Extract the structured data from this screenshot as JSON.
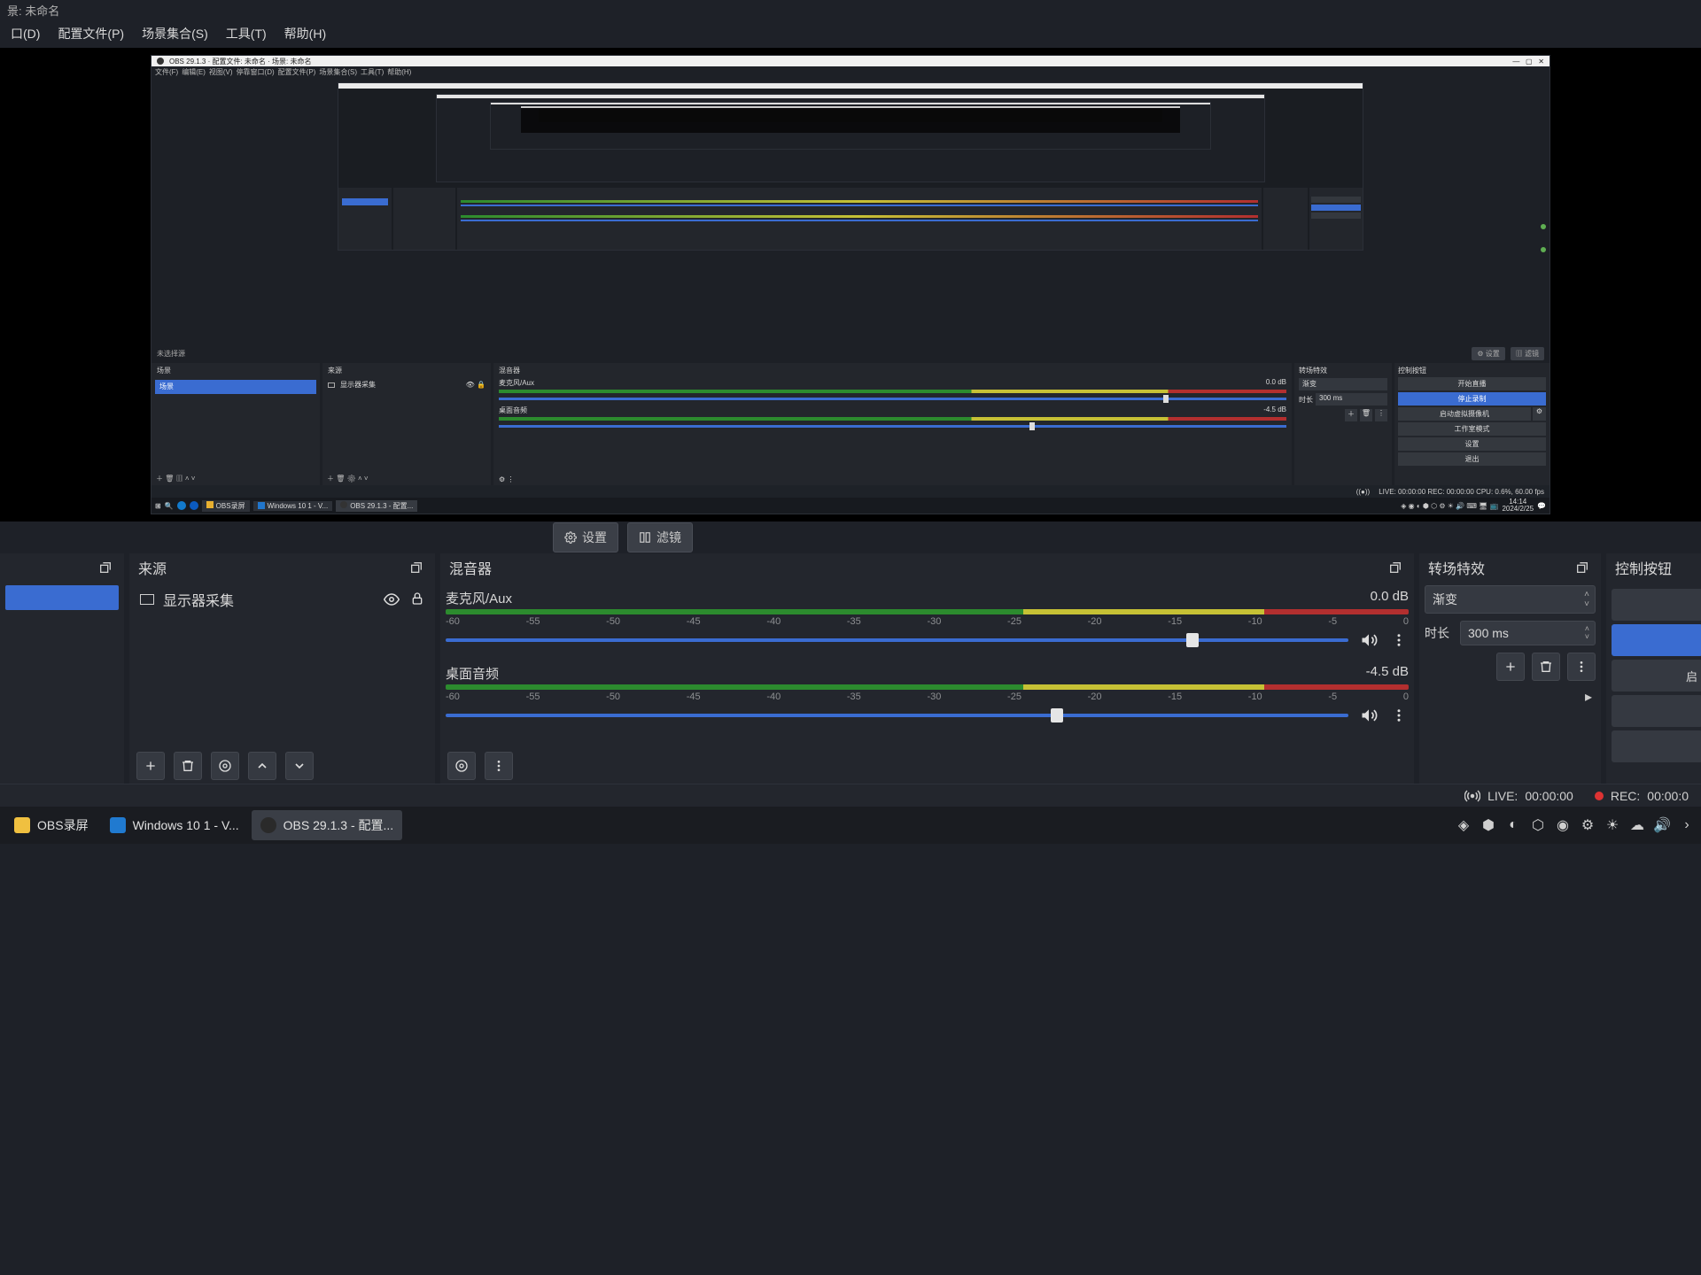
{
  "title": "景: 未命名",
  "menu": [
    "口(D)",
    "配置文件(P)",
    "场景集合(S)",
    "工具(T)",
    "帮助(H)"
  ],
  "preview_toolbar": {
    "no_selection": "未选择源",
    "settings": "设置",
    "filters": "滤镜"
  },
  "scenes": {
    "title": "",
    "pop": "⧉",
    "items": [
      ""
    ]
  },
  "sources": {
    "title": "来源",
    "items": [
      {
        "label": "显示器采集"
      }
    ]
  },
  "mixer": {
    "title": "混音器",
    "channels": [
      {
        "name": "麦克风/Aux",
        "db": "0.0 dB",
        "ticks": [
          "-60",
          "-55",
          "-50",
          "-45",
          "-40",
          "-35",
          "-30",
          "-25",
          "-20",
          "-15",
          "-10",
          "-5",
          "0"
        ],
        "knob": 82
      },
      {
        "name": "桌面音频",
        "db": "-4.5 dB",
        "ticks": [
          "-60",
          "-55",
          "-50",
          "-45",
          "-40",
          "-35",
          "-30",
          "-25",
          "-20",
          "-15",
          "-10",
          "-5",
          "0"
        ],
        "knob": 67
      }
    ]
  },
  "transitions": {
    "title": "转场特效",
    "type": "渐变",
    "duration_label": "时长",
    "duration": "300 ms"
  },
  "controls": {
    "title": "控制按钮",
    "buttons": [
      "",
      "",
      "启"
    ]
  },
  "status": {
    "live_label": "LIVE:",
    "live_time": "00:00:00",
    "rec_label": "REC:",
    "rec_time": "00:00:0"
  },
  "taskbar": {
    "items": [
      {
        "label": "OBS录屏",
        "icon": "#f0c040"
      },
      {
        "label": "Windows 10 1 - V...",
        "icon": "#207ad0"
      },
      {
        "label": "OBS 29.1.3 - 配置...",
        "icon": "#444"
      }
    ]
  },
  "inner_preview": {
    "title": "OBS 29.1.3 · 配置文件: 未命名 · 场景: 未命名",
    "menu": [
      "文件(F)",
      "编辑(E)",
      "视图(V)",
      "停靠窗口(D)",
      "配置文件(P)",
      "场景集合(S)",
      "工具(T)",
      "帮助(H)"
    ],
    "panels": {
      "scenes": "场景",
      "sources": "来源",
      "mixer": "混音器",
      "trans": "转场特效",
      "controls": "控制按钮"
    },
    "scene": "场景",
    "source": "显示器采集",
    "mix1": "麦克风/Aux",
    "mix1db": "0.0 dB",
    "mix2": "桌面音频",
    "mix2db": "-4.5 dB",
    "dur_lbl": "时长",
    "dur": "300 ms",
    "trans_type": "渐变",
    "btns": [
      "开始直播",
      "停止录制",
      "启动虚拟摄像机",
      "工作室模式",
      "设置",
      "退出"
    ],
    "status": "LIVE: 00:00:00     REC: 00:00:00     CPU: 0.6%, 60.00 fps",
    "time": "14:14",
    "date": "2024/2/25",
    "task": [
      "OBS录屏",
      "Windows 10 1 - V...",
      "OBS 29.1.3 - 配置..."
    ]
  }
}
